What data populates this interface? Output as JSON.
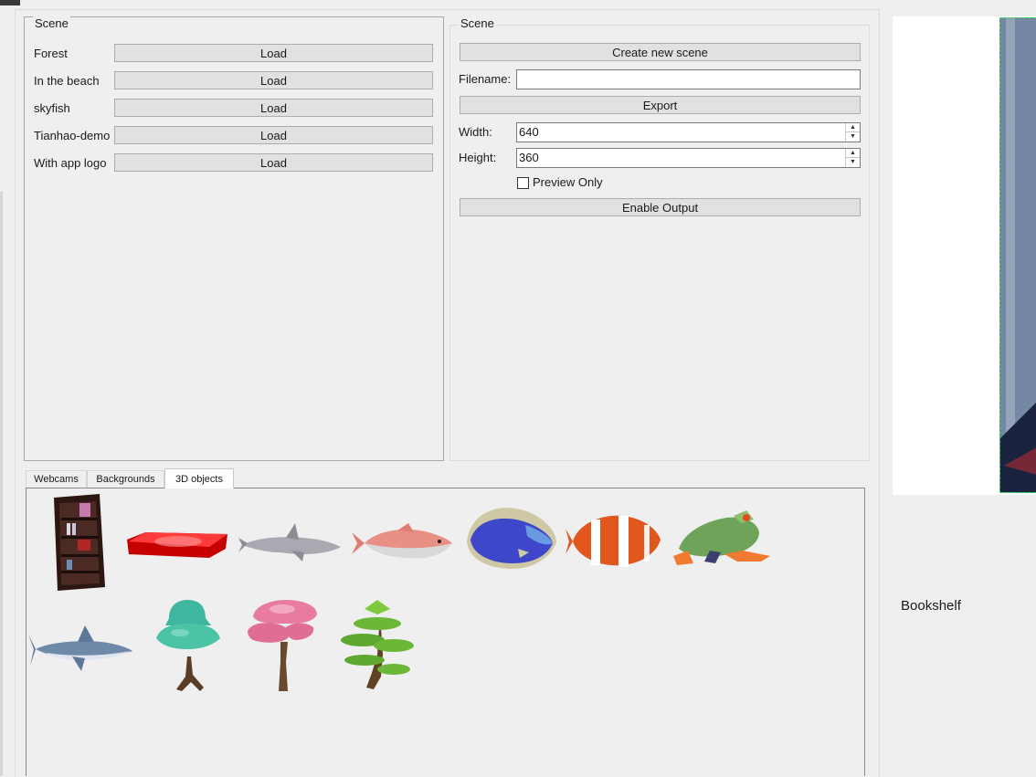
{
  "left_panel": {
    "title": "Scene",
    "scenes": [
      {
        "name": "Forest",
        "button": "Load"
      },
      {
        "name": "In the beach",
        "button": "Load"
      },
      {
        "name": "skyfish",
        "button": "Load"
      },
      {
        "name": "Tianhao-demo",
        "button": "Load"
      },
      {
        "name": "With app logo",
        "button": "Load"
      }
    ]
  },
  "right_panel": {
    "title": "Scene",
    "create_button": "Create new scene",
    "filename_label": "Filename:",
    "filename_value": "",
    "export_button": "Export",
    "width_label": "Width:",
    "width_value": "640",
    "height_label": "Height:",
    "height_value": "360",
    "preview_only_label": "Preview Only",
    "preview_only_checked": false,
    "enable_output_button": "Enable Output"
  },
  "tabs": [
    {
      "label": "Webcams",
      "active": false
    },
    {
      "label": "Backgrounds",
      "active": false
    },
    {
      "label": "3D objects",
      "active": true
    }
  ],
  "objects_row1": [
    "bookshelf",
    "red-slab",
    "dolphin",
    "salmon-fish",
    "blue-tang-fish",
    "clownfish",
    "frog"
  ],
  "objects_row2": [
    "shark",
    "green-tree",
    "pink-tree",
    "bonsai-tree"
  ],
  "selected_object_label": "Bookshelf",
  "colors": {
    "accent_dashed": "#39e64a",
    "button_bg": "#e1e1e1",
    "window_bg": "#f0eff0"
  }
}
